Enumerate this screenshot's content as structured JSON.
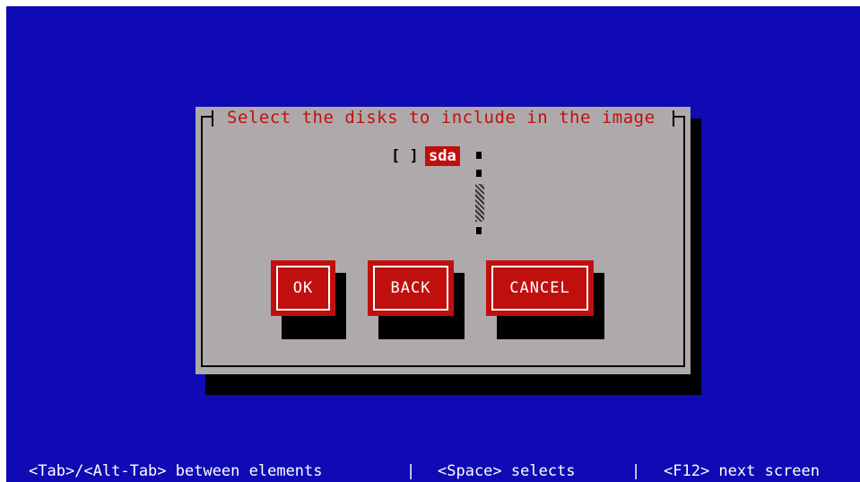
{
  "dialog": {
    "title": "Select the disks to include in the image",
    "disks": [
      {
        "checkbox": "[ ]",
        "label": "sda",
        "checked": false,
        "focused": true
      }
    ]
  },
  "buttons": {
    "ok": "OK",
    "back": "BACK",
    "cancel": "CANCEL"
  },
  "help_bar": {
    "tab_hint": "<Tab>/<Alt-Tab> between elements",
    "sep1": "|",
    "space_hint": "<Space> selects",
    "sep2": "|",
    "f12_hint": "<F12> next screen"
  },
  "colors": {
    "background": "#0f0ab3",
    "dialog": "#aeaaab",
    "accent": "#c0100e",
    "shadow": "#000000"
  }
}
